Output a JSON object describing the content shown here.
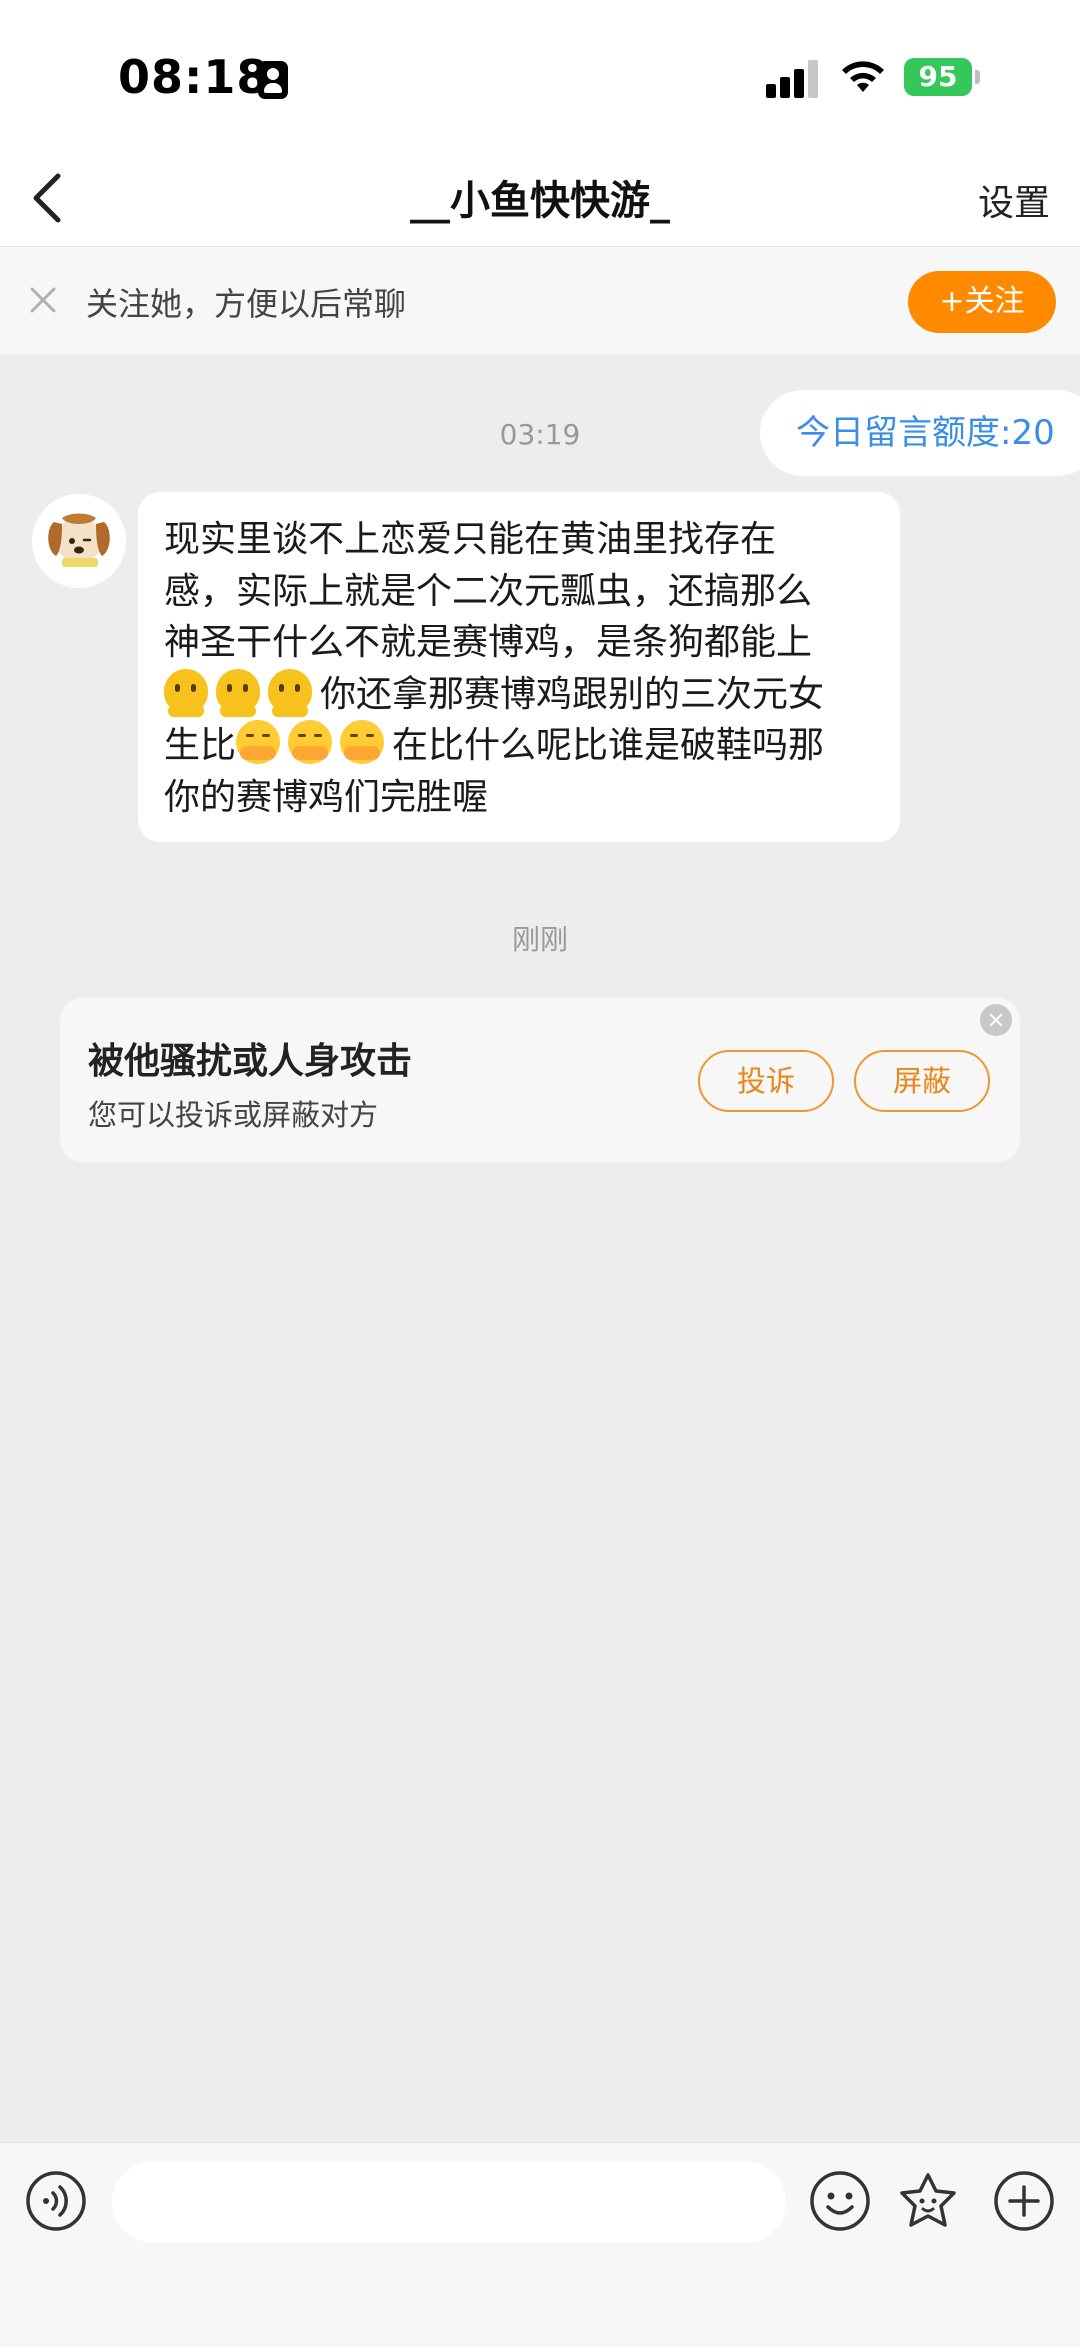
{
  "status_bar": {
    "time": "08:18",
    "battery": "95"
  },
  "nav": {
    "title": "__小鱼快快游_",
    "settings_label": "设置",
    "back_icon": "chevron-left-icon"
  },
  "follow_banner": {
    "text": "关注她，方便以后常聊",
    "button_label": "+关注",
    "accent_color": "#ff8a00"
  },
  "chat": {
    "quota_text": "今日留言额度:20",
    "first_timestamp": "03:19",
    "message": {
      "line1": "现实里谈不上恋爱只能在黄油里找存在",
      "line2": "感，实际上就是个二次元瓢虫，还搞那么",
      "line3": "神圣干什么不就是赛博鸡，是条狗都能上",
      "line4_text": "你还拿那赛博鸡跟别的三次元女",
      "line5_prefix": "生比",
      "line5_text": "在比什么呢比谁是破鞋吗那",
      "line6": "你的赛博鸡们完胜喔"
    },
    "second_timestamp": "刚刚"
  },
  "report_card": {
    "title": "被他骚扰或人身攻击",
    "subtitle": "您可以投诉或屏蔽对方",
    "complain_label": "投诉",
    "block_label": "屏蔽"
  },
  "input_bar": {
    "placeholder": ""
  }
}
